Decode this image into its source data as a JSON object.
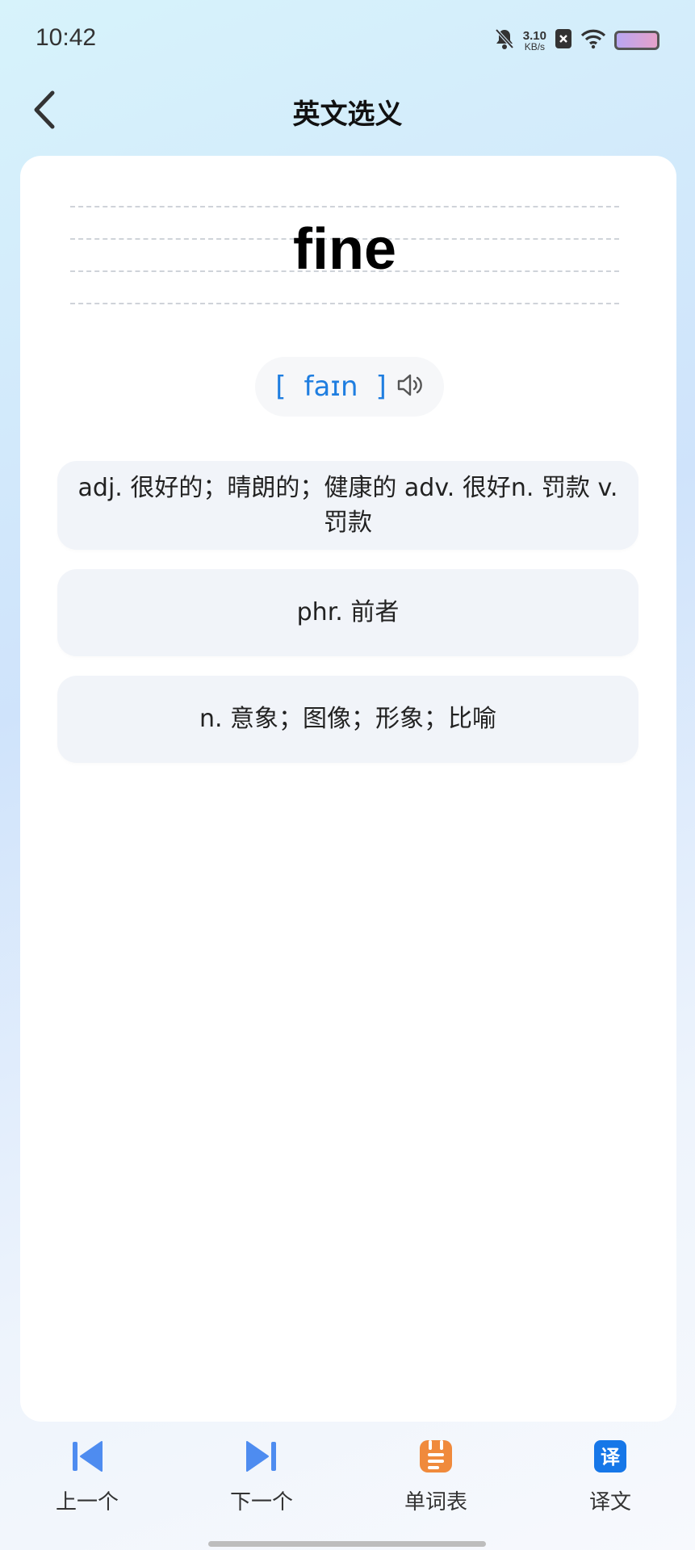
{
  "status_bar": {
    "time": "10:42",
    "net_speed_value": "3.10",
    "net_speed_unit": "KB/s",
    "icons": [
      "bell-muted-icon",
      "sim-off-icon",
      "wifi-icon",
      "battery-icon"
    ]
  },
  "header": {
    "title": "英文选义",
    "back_icon": "chevron-left-icon"
  },
  "word": {
    "text": "fine",
    "phonetic_open": "[",
    "phonetic": "faɪn",
    "phonetic_close": "]",
    "audio_icon": "speaker-icon"
  },
  "options": [
    {
      "text": "adj. 很好的；晴朗的；健康的 adv. 很好n. 罚款 v. 罚款"
    },
    {
      "text": "phr. 前者"
    },
    {
      "text": "n. 意象；图像；形象；比喻"
    }
  ],
  "bottom_nav": [
    {
      "label": "上一个",
      "icon": "skip-previous-icon"
    },
    {
      "label": "下一个",
      "icon": "skip-next-icon"
    },
    {
      "label": "单词表",
      "icon": "word-list-icon"
    },
    {
      "label": "译文",
      "icon": "translate-icon"
    }
  ],
  "colors": {
    "accent_blue": "#1f7ee0",
    "nav_blue": "#4e8cf0",
    "nav_orange": "#f08a3c",
    "translate_blue": "#1677e8"
  }
}
